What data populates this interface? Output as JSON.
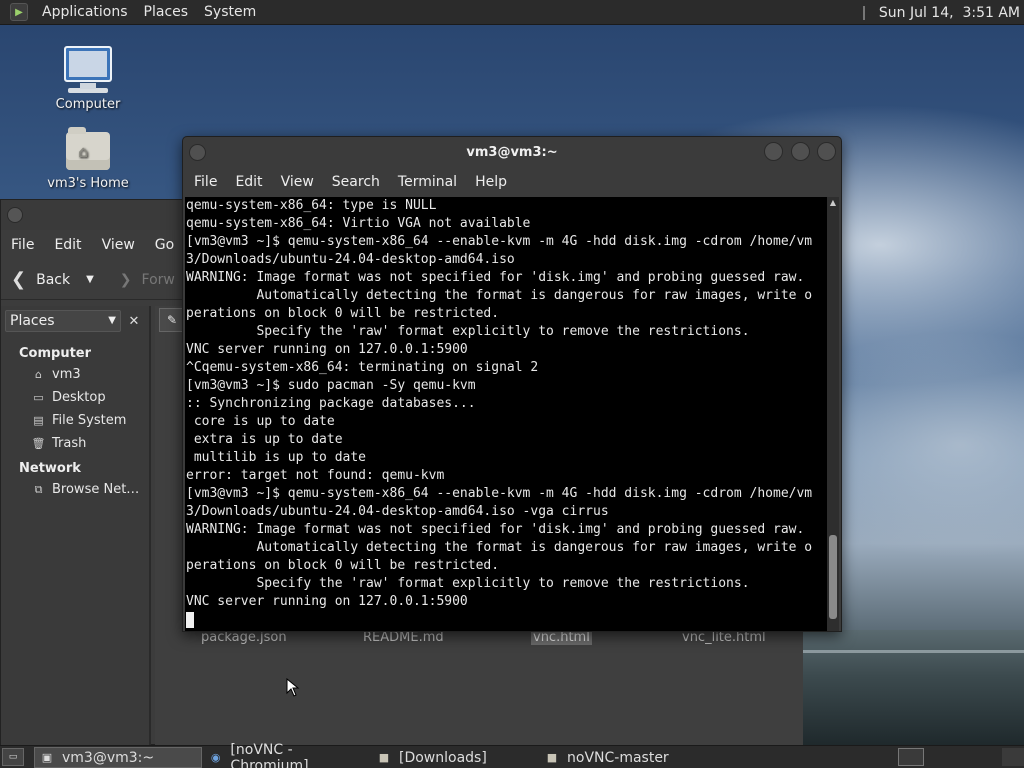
{
  "top_panel": {
    "menus": [
      "Applications",
      "Places",
      "System"
    ],
    "clock": "Sun Jul 14,  3:51 AM"
  },
  "desktop": {
    "icons": [
      {
        "label": "Computer"
      },
      {
        "label": "vm3's Home"
      }
    ]
  },
  "file_manager": {
    "menu": [
      "File",
      "Edit",
      "View",
      "Go"
    ],
    "back_label": "Back",
    "forward_label": "Forw",
    "places_label": "Places",
    "sections": [
      {
        "title": "Computer",
        "items": [
          {
            "label": "vm3",
            "icon": "home-icon"
          },
          {
            "label": "Desktop",
            "icon": "desktop-icon"
          },
          {
            "label": "File System",
            "icon": "drive-icon"
          },
          {
            "label": "Trash",
            "icon": "trash-icon"
          }
        ]
      },
      {
        "title": "Network",
        "items": [
          {
            "label": "Browse Net…",
            "icon": "network-icon"
          }
        ]
      }
    ],
    "files": [
      "package.json",
      "README.md",
      "vnc.html",
      "vnc_lite.html"
    ]
  },
  "terminal": {
    "title": "vm3@vm3:~",
    "menu": [
      "File",
      "Edit",
      "View",
      "Search",
      "Terminal",
      "Help"
    ],
    "lines": [
      "qemu-system-x86_64: type is NULL",
      "qemu-system-x86_64: Virtio VGA not available",
      "[vm3@vm3 ~]$ qemu-system-x86_64 --enable-kvm -m 4G -hdd disk.img -cdrom /home/vm",
      "3/Downloads/ubuntu-24.04-desktop-amd64.iso",
      "WARNING: Image format was not specified for 'disk.img' and probing guessed raw.",
      "         Automatically detecting the format is dangerous for raw images, write o",
      "perations on block 0 will be restricted.",
      "         Specify the 'raw' format explicitly to remove the restrictions.",
      "VNC server running on 127.0.0.1:5900",
      "^Cqemu-system-x86_64: terminating on signal 2",
      "[vm3@vm3 ~]$ sudo pacman -Sy qemu-kvm",
      ":: Synchronizing package databases...",
      " core is up to date",
      " extra is up to date",
      " multilib is up to date",
      "error: target not found: qemu-kvm",
      "[vm3@vm3 ~]$ qemu-system-x86_64 --enable-kvm -m 4G -hdd disk.img -cdrom /home/vm",
      "3/Downloads/ubuntu-24.04-desktop-amd64.iso -vga cirrus",
      "WARNING: Image format was not specified for 'disk.img' and probing guessed raw.",
      "         Automatically detecting the format is dangerous for raw images, write o",
      "perations on block 0 will be restricted.",
      "         Specify the 'raw' format explicitly to remove the restrictions.",
      "VNC server running on 127.0.0.1:5900"
    ]
  },
  "taskbar": {
    "items": [
      {
        "label": "vm3@vm3:~",
        "icon": "terminal-icon",
        "active": true
      },
      {
        "label": "[noVNC - Chromium]",
        "icon": "chromium-icon",
        "active": false
      },
      {
        "label": "[Downloads]",
        "icon": "folder-icon",
        "active": false
      },
      {
        "label": "noVNC-master",
        "icon": "folder-icon",
        "active": false
      }
    ]
  }
}
